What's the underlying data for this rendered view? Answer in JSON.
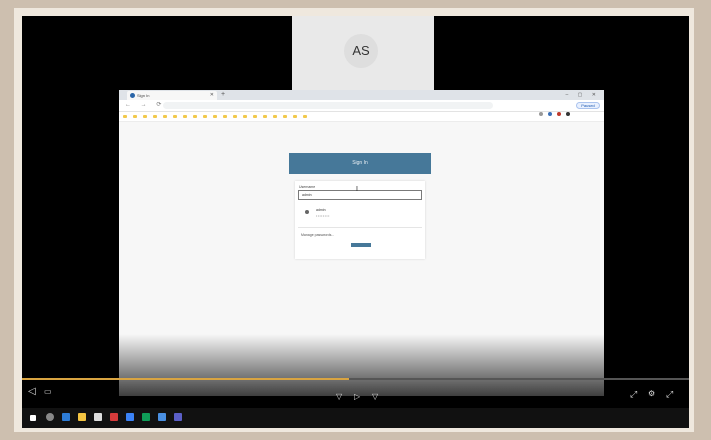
{
  "participant": {
    "initials": "AS"
  },
  "browser": {
    "tab_title": "Sign In",
    "address": "",
    "pause_label": "Paused",
    "bookmarks": [
      "",
      "",
      "",
      "",
      "",
      "",
      "",
      "",
      "",
      "",
      "",
      "",
      "",
      "",
      "",
      "",
      "",
      "",
      ""
    ]
  },
  "signin": {
    "header": "Sign In",
    "username_label": "Username",
    "username_value": "admin",
    "suggestion_user": "admin",
    "suggestion_password": "••••••••",
    "manage_link": "Manage passwords..."
  },
  "player": {
    "progress_fraction": 0.49
  },
  "colors": {
    "header_bg": "#467899",
    "progress": "#d9a441",
    "frame_outer": "#cdbfaf"
  },
  "icons": {
    "prev": "skip-previous-icon",
    "play": "play-icon",
    "next": "skip-next-icon",
    "volume": "volume-icon",
    "captions": "captions-icon",
    "fullscreen": "fullscreen-icon"
  }
}
